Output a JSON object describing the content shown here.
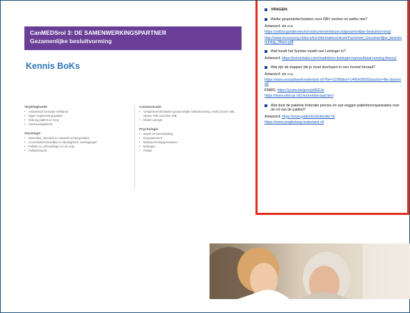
{
  "banner": {
    "line1": "CanMEDSrol 3: DE SAMENWERKINGSPARTNER",
    "line2": "Gezamenlijke besluitvorming"
  },
  "title": "Kennis BoKs",
  "left_column": [
    {
      "heading": "Verpleegkunde",
      "items": [
        "Anatomisch beroeps-richtlijnen",
        "Eigen regievoering patiënt",
        "Dialoog patiënt en zorg",
        "Casemanagement"
      ]
    },
    {
      "heading": "Sociologie",
      "items": [
        "Diversiteit, ethiciteit en culturele achtergronden",
        "Levensbeschouwelijke en ideologische overtuigingen",
        "Politiek en verhoudingen in de zorg",
        "Politiek/macht"
      ]
    }
  ],
  "right_column": [
    {
      "heading": "Communicatie",
      "items": [
        "Gespreksmethodieken gezamenlijke besluitvorming, zoals Choice Talk, Option Talk, Decision Talk",
        "Model Leiniger"
      ]
    },
    {
      "heading": "Psychologie",
      "items": [
        "Macht en beïnvloeding",
        "Empowerment",
        "Besluitvormingsprocessen",
        "Belangen",
        "Positie"
      ]
    }
  ],
  "panel": {
    "heading": "VRAGEN:",
    "q1": "Welke gesprekstechnieken  voor GBV werken en welke niet?",
    "q1_answer": "Antwoord: zie o.a.",
    "q1_link1": "https://zelfzorgondersteund-instrumentenkiezer.nl/gezamenlijke-besluitvorming/",
    "q1_link2": "http://www.invoorzorg.nl/docs/ivz/informatiecentrum/Factsheet_Gezamenlijke_besluitvorming_Vilans.pdf",
    "q2": "Wat houdt het Sunrise model van Leininger in?",
    "q2_answer_label": "Antwoord:",
    "q2_link": "https://nurseslabs.com/madeleine-leininger-transcultural-nursing-theory/",
    "q3": "Wat zijn de stappen die je moet doorlopen in een moreel beraad?",
    "q3_answer": "Antwoord: zie o.a.",
    "q3_link1": "https://www.sociaalwerknederland.nl/?file=11985&m=1445429925&action=file.download",
    "q3_knmg_label": "KNMG:",
    "q3_link2": "https://youtu.be/goxvjx0EDJo",
    "q3_link3": "https://www.ethicas.nl/1/moreelberaad.html",
    "q4": "Wat doet de patiënte federatie precies en wat zeggen patiëntenorganisaties over de rol van de patiënt?",
    "q4_answer_label": "Antwoord:",
    "q4_link1": "https://www.patientenfederatie.nl/",
    "q4_link2": "https://www.zorgbelang-nederland.nl/"
  },
  "colors": {
    "banner": "#6a3e97",
    "title": "#2e75b6",
    "panel_border": "#e02b20",
    "link": "#1f5fbf",
    "bullet": "#1f3d99"
  }
}
